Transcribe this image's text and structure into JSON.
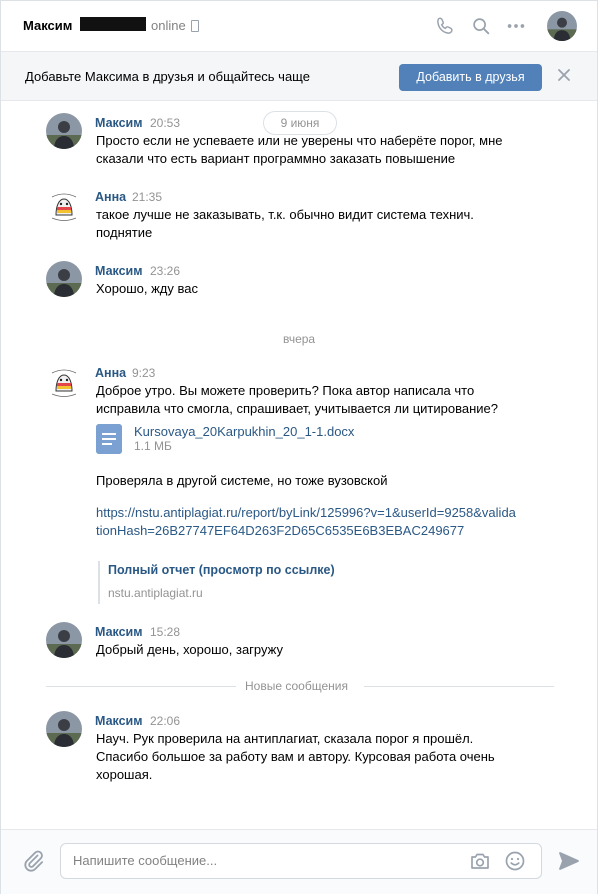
{
  "header": {
    "name": "Максим",
    "status": "online"
  },
  "friend_bar": {
    "text": "Добавьте Максима в друзья и общайтесь чаще",
    "button": "Добавить в друзья"
  },
  "dates": {
    "first": "9 июня",
    "yesterday": "вчера",
    "new_messages": "Новые сообщения"
  },
  "messages": [
    {
      "author": "Максим",
      "time": "20:53",
      "text": "Просто если не успеваете или не уверены что наберёте порог, мне сказали что есть вариант программно заказать повышение"
    },
    {
      "author": "Анна",
      "time": "21:35",
      "text": "такое лучше не заказывать, т.к. обычно видит система технич. поднятие"
    },
    {
      "author": "Максим",
      "time": "23:26",
      "text": "Хорошо, жду вас"
    },
    {
      "author": "Анна",
      "time": "9:23",
      "text": "Доброе утро. Вы можете проверить? Пока автор написала что исправила что смогла, спрашивает, учитывается ли цитирование?",
      "file": {
        "name": "Kursovaya_20Karpukhin_20_1-1.docx",
        "size": "1.1 МБ"
      },
      "text2": "Проверяла в другой системе, но тоже вузовской",
      "link": "https://nstu.antiplagiat.ru/report/byLink/125996?v=1&userId=9258&validationHash=26B27747EF64D263F2D65C6535E6B3EBAC249677",
      "snippet": {
        "title": "Полный отчет (просмотр по ссылке)",
        "domain": "nstu.antiplagiat.ru"
      }
    },
    {
      "author": "Максим",
      "time": "15:28",
      "text": "Добрый день, хорошо, загружу"
    },
    {
      "author": "Максим",
      "time": "22:06",
      "text": "Науч. Рук проверила на антиплагиат, сказала порог я прошёл. Спасибо большое за работу вам и автору. Курсовая работа очень хорошая."
    }
  ],
  "composer": {
    "placeholder": "Напишите сообщение..."
  },
  "colors": {
    "accent": "#5181b8",
    "link": "#2a5885",
    "muted": "#939393"
  },
  "icons": [
    "phone-icon",
    "search-icon",
    "more-icon",
    "close-icon",
    "attach-icon",
    "camera-icon",
    "smile-icon",
    "send-icon",
    "document-icon"
  ]
}
